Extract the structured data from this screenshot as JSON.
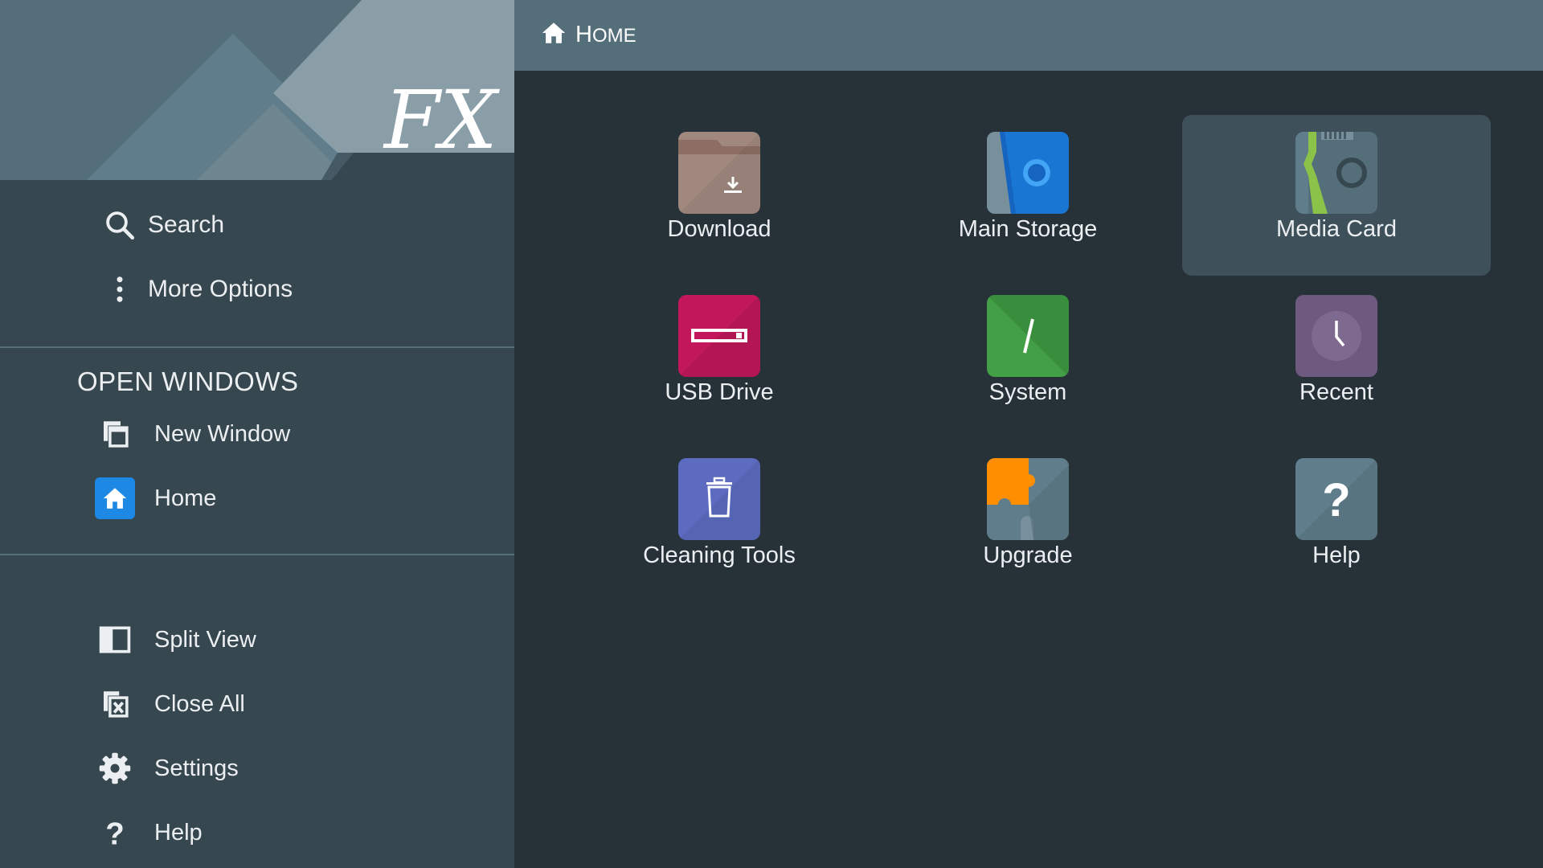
{
  "app": {
    "logo_text": "FX"
  },
  "breadcrumb": {
    "first_letter": "H",
    "rest": "OME",
    "icon": "home-icon"
  },
  "sidebar": {
    "top_items": [
      {
        "label": "Search",
        "icon": "search-icon"
      },
      {
        "label": "More Options",
        "icon": "more-vertical-icon"
      }
    ],
    "open_windows_title": "OPEN WINDOWS",
    "windows": [
      {
        "label": "New Window",
        "icon": "new-window-icon"
      },
      {
        "label": "Home",
        "icon": "home-icon",
        "active": true
      }
    ],
    "bottom_items": [
      {
        "label": "Split View",
        "icon": "split-view-icon"
      },
      {
        "label": "Close All",
        "icon": "close-all-icon"
      },
      {
        "label": "Settings",
        "icon": "gear-icon"
      },
      {
        "label": "Help",
        "icon": "question-icon"
      }
    ]
  },
  "tiles": [
    {
      "label": "Download",
      "icon": "download-folder-icon",
      "color": "#a1887f"
    },
    {
      "label": "Main Storage",
      "icon": "main-storage-icon",
      "color": "#1976d2"
    },
    {
      "label": "Media Card",
      "icon": "media-card-icon",
      "color": "#546e7a",
      "selected": true
    },
    {
      "label": "USB Drive",
      "icon": "usb-drive-icon",
      "color": "#c2185b"
    },
    {
      "label": "System",
      "icon": "system-icon",
      "color": "#43a047"
    },
    {
      "label": "Recent",
      "icon": "clock-icon",
      "color": "#6d5a7e"
    },
    {
      "label": "Cleaning Tools",
      "icon": "trash-icon",
      "color": "#5c6bc0"
    },
    {
      "label": "Upgrade",
      "icon": "puzzle-icon",
      "color": "#ff8f00"
    },
    {
      "label": "Help",
      "icon": "help-icon",
      "color": "#607d8b"
    }
  ],
  "colors": {
    "sidebar_bg": "#37474f",
    "main_bg": "#263238",
    "topbar_bg": "#546e7a",
    "accent": "#1e88e5"
  }
}
